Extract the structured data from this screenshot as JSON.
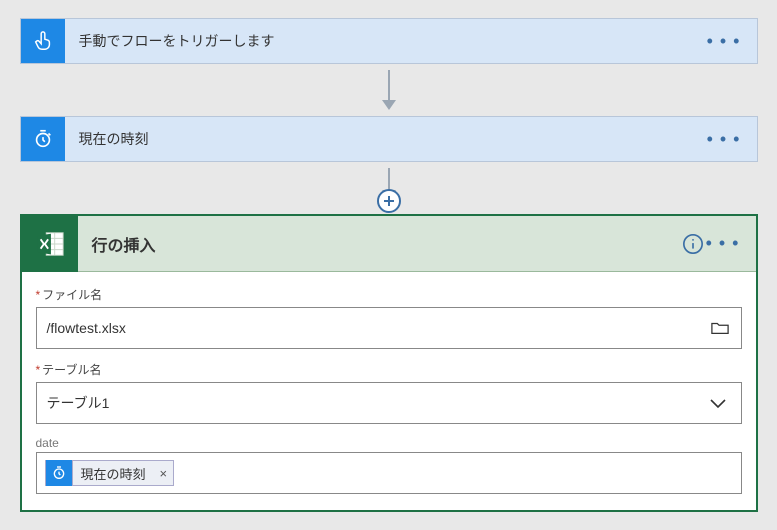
{
  "steps": {
    "trigger": {
      "title": "手動でフローをトリガーします"
    },
    "current_time": {
      "title": "現在の時刻"
    },
    "insert_row": {
      "title": "行の挿入",
      "fields": {
        "file_label": "ファイル名",
        "file_value": "/flowtest.xlsx",
        "table_label": "テーブル名",
        "table_value": "テーブル1",
        "date_label": "date",
        "date_pill": "現在の時刻"
      }
    }
  }
}
